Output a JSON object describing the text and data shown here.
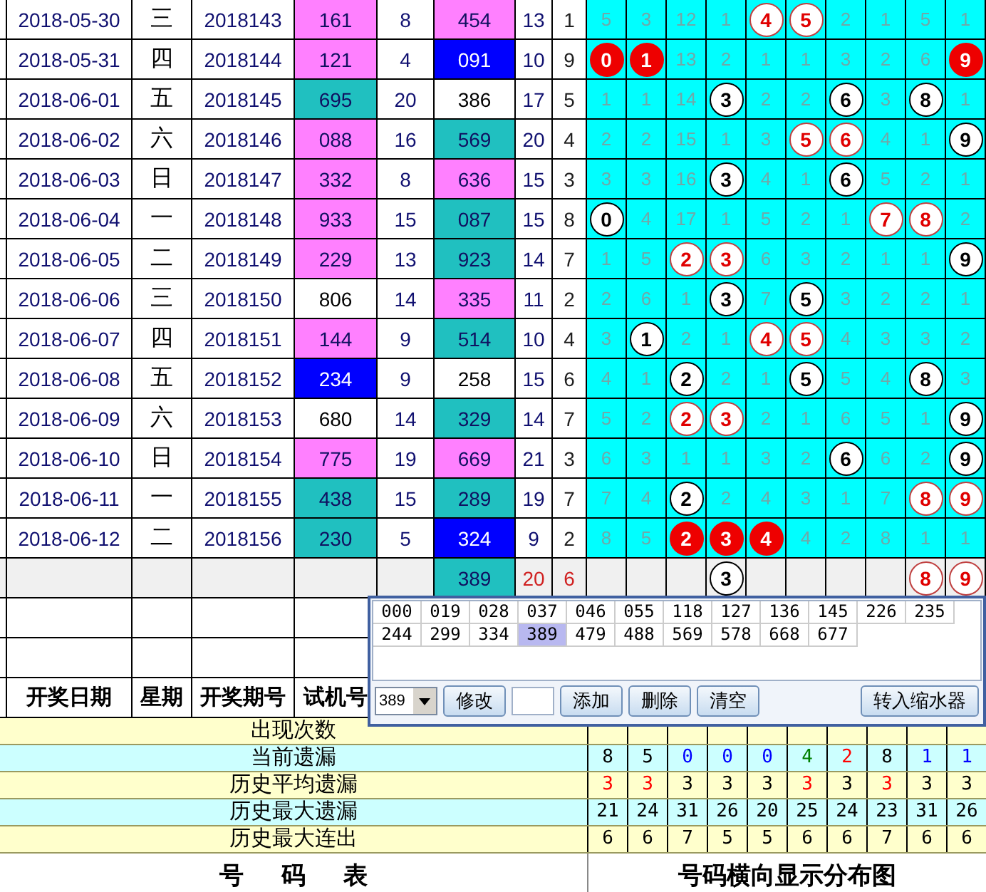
{
  "draws": [
    {
      "date": "2018-05-30",
      "weekday": "三",
      "period": "2018143",
      "trial": {
        "text": "161",
        "color": "#ff80ff"
      },
      "count": "8",
      "result": {
        "text": "454",
        "color": "#ff80ff"
      },
      "sum": "13",
      "span": "1",
      "grid": [
        {
          "text": "5",
          "kind": "gap"
        },
        {
          "text": "3",
          "kind": "gap"
        },
        {
          "text": "12",
          "kind": "gap"
        },
        {
          "text": "1",
          "kind": "gap"
        },
        {
          "text": "4",
          "kind": "red"
        },
        {
          "text": "5",
          "kind": "red"
        },
        {
          "text": "2",
          "kind": "gap"
        },
        {
          "text": "1",
          "kind": "gap"
        },
        {
          "text": "5",
          "kind": "gap"
        },
        {
          "text": "1",
          "kind": "gap"
        }
      ]
    },
    {
      "date": "2018-05-31",
      "weekday": "四",
      "period": "2018144",
      "trial": {
        "text": "121",
        "color": "#ff80ff"
      },
      "count": "4",
      "result": {
        "text": "091",
        "color": "#0000ff"
      },
      "sum": "10",
      "span": "9",
      "grid": [
        {
          "text": "0",
          "kind": "solid"
        },
        {
          "text": "1",
          "kind": "solid"
        },
        {
          "text": "13",
          "kind": "gap"
        },
        {
          "text": "2",
          "kind": "gap"
        },
        {
          "text": "1",
          "kind": "gap"
        },
        {
          "text": "1",
          "kind": "gap"
        },
        {
          "text": "3",
          "kind": "gap"
        },
        {
          "text": "2",
          "kind": "gap"
        },
        {
          "text": "6",
          "kind": "gap"
        },
        {
          "text": "9",
          "kind": "solid"
        }
      ]
    },
    {
      "date": "2018-06-01",
      "weekday": "五",
      "period": "2018145",
      "trial": {
        "text": "695",
        "color": "#20c0c0"
      },
      "count": "20",
      "result": {
        "text": "386",
        "color": "#ffffff"
      },
      "sum": "17",
      "span": "5",
      "grid": [
        {
          "text": "1",
          "kind": "gap"
        },
        {
          "text": "1",
          "kind": "gap"
        },
        {
          "text": "14",
          "kind": "gap"
        },
        {
          "text": "3",
          "kind": "black"
        },
        {
          "text": "2",
          "kind": "gap"
        },
        {
          "text": "2",
          "kind": "gap"
        },
        {
          "text": "6",
          "kind": "black"
        },
        {
          "text": "3",
          "kind": "gap"
        },
        {
          "text": "8",
          "kind": "black"
        },
        {
          "text": "1",
          "kind": "gap"
        }
      ]
    },
    {
      "date": "2018-06-02",
      "weekday": "六",
      "period": "2018146",
      "trial": {
        "text": "088",
        "color": "#ff80ff"
      },
      "count": "16",
      "result": {
        "text": "569",
        "color": "#20c0c0"
      },
      "sum": "20",
      "span": "4",
      "grid": [
        {
          "text": "2",
          "kind": "gap"
        },
        {
          "text": "2",
          "kind": "gap"
        },
        {
          "text": "15",
          "kind": "gap"
        },
        {
          "text": "1",
          "kind": "gap"
        },
        {
          "text": "3",
          "kind": "gap"
        },
        {
          "text": "5",
          "kind": "red"
        },
        {
          "text": "6",
          "kind": "red"
        },
        {
          "text": "4",
          "kind": "gap"
        },
        {
          "text": "1",
          "kind": "gap"
        },
        {
          "text": "9",
          "kind": "black"
        }
      ]
    },
    {
      "date": "2018-06-03",
      "weekday": "日",
      "period": "2018147",
      "trial": {
        "text": "332",
        "color": "#ff80ff"
      },
      "count": "8",
      "result": {
        "text": "636",
        "color": "#ff80ff"
      },
      "sum": "15",
      "span": "3",
      "grid": [
        {
          "text": "3",
          "kind": "gap"
        },
        {
          "text": "3",
          "kind": "gap"
        },
        {
          "text": "16",
          "kind": "gap"
        },
        {
          "text": "3",
          "kind": "black"
        },
        {
          "text": "4",
          "kind": "gap"
        },
        {
          "text": "1",
          "kind": "gap"
        },
        {
          "text": "6",
          "kind": "black"
        },
        {
          "text": "5",
          "kind": "gap"
        },
        {
          "text": "2",
          "kind": "gap"
        },
        {
          "text": "1",
          "kind": "gap"
        }
      ]
    },
    {
      "date": "2018-06-04",
      "weekday": "一",
      "period": "2018148",
      "trial": {
        "text": "933",
        "color": "#ff80ff"
      },
      "count": "15",
      "result": {
        "text": "087",
        "color": "#20c0c0"
      },
      "sum": "15",
      "span": "8",
      "grid": [
        {
          "text": "0",
          "kind": "black"
        },
        {
          "text": "4",
          "kind": "gap"
        },
        {
          "text": "17",
          "kind": "gap"
        },
        {
          "text": "1",
          "kind": "gap"
        },
        {
          "text": "5",
          "kind": "gap"
        },
        {
          "text": "2",
          "kind": "gap"
        },
        {
          "text": "1",
          "kind": "gap"
        },
        {
          "text": "7",
          "kind": "red"
        },
        {
          "text": "8",
          "kind": "red"
        },
        {
          "text": "2",
          "kind": "gap"
        }
      ]
    },
    {
      "date": "2018-06-05",
      "weekday": "二",
      "period": "2018149",
      "trial": {
        "text": "229",
        "color": "#ff80ff"
      },
      "count": "13",
      "result": {
        "text": "923",
        "color": "#20c0c0"
      },
      "sum": "14",
      "span": "7",
      "grid": [
        {
          "text": "1",
          "kind": "gap"
        },
        {
          "text": "5",
          "kind": "gap"
        },
        {
          "text": "2",
          "kind": "red"
        },
        {
          "text": "3",
          "kind": "red"
        },
        {
          "text": "6",
          "kind": "gap"
        },
        {
          "text": "3",
          "kind": "gap"
        },
        {
          "text": "2",
          "kind": "gap"
        },
        {
          "text": "1",
          "kind": "gap"
        },
        {
          "text": "1",
          "kind": "gap"
        },
        {
          "text": "9",
          "kind": "black"
        }
      ]
    },
    {
      "date": "2018-06-06",
      "weekday": "三",
      "period": "2018150",
      "trial": {
        "text": "806",
        "color": "#ffffff"
      },
      "count": "14",
      "result": {
        "text": "335",
        "color": "#ff80ff"
      },
      "sum": "11",
      "span": "2",
      "grid": [
        {
          "text": "2",
          "kind": "gap"
        },
        {
          "text": "6",
          "kind": "gap"
        },
        {
          "text": "1",
          "kind": "gap"
        },
        {
          "text": "3",
          "kind": "black"
        },
        {
          "text": "7",
          "kind": "gap"
        },
        {
          "text": "5",
          "kind": "black"
        },
        {
          "text": "3",
          "kind": "gap"
        },
        {
          "text": "2",
          "kind": "gap"
        },
        {
          "text": "2",
          "kind": "gap"
        },
        {
          "text": "1",
          "kind": "gap"
        }
      ]
    },
    {
      "date": "2018-06-07",
      "weekday": "四",
      "period": "2018151",
      "trial": {
        "text": "144",
        "color": "#ff80ff"
      },
      "count": "9",
      "result": {
        "text": "514",
        "color": "#20c0c0"
      },
      "sum": "10",
      "span": "4",
      "grid": [
        {
          "text": "3",
          "kind": "gap"
        },
        {
          "text": "1",
          "kind": "black"
        },
        {
          "text": "2",
          "kind": "gap"
        },
        {
          "text": "1",
          "kind": "gap"
        },
        {
          "text": "4",
          "kind": "red"
        },
        {
          "text": "5",
          "kind": "red"
        },
        {
          "text": "4",
          "kind": "gap"
        },
        {
          "text": "3",
          "kind": "gap"
        },
        {
          "text": "3",
          "kind": "gap"
        },
        {
          "text": "2",
          "kind": "gap"
        }
      ]
    },
    {
      "date": "2018-06-08",
      "weekday": "五",
      "period": "2018152",
      "trial": {
        "text": "234",
        "color": "#0000ff"
      },
      "count": "9",
      "result": {
        "text": "258",
        "color": "#ffffff"
      },
      "sum": "15",
      "span": "6",
      "grid": [
        {
          "text": "4",
          "kind": "gap"
        },
        {
          "text": "1",
          "kind": "gap"
        },
        {
          "text": "2",
          "kind": "black"
        },
        {
          "text": "2",
          "kind": "gap"
        },
        {
          "text": "1",
          "kind": "gap"
        },
        {
          "text": "5",
          "kind": "black"
        },
        {
          "text": "5",
          "kind": "gap"
        },
        {
          "text": "4",
          "kind": "gap"
        },
        {
          "text": "8",
          "kind": "black"
        },
        {
          "text": "3",
          "kind": "gap"
        }
      ]
    },
    {
      "date": "2018-06-09",
      "weekday": "六",
      "period": "2018153",
      "trial": {
        "text": "680",
        "color": "#ffffff"
      },
      "count": "14",
      "result": {
        "text": "329",
        "color": "#20c0c0"
      },
      "sum": "14",
      "span": "7",
      "grid": [
        {
          "text": "5",
          "kind": "gap"
        },
        {
          "text": "2",
          "kind": "gap"
        },
        {
          "text": "2",
          "kind": "red"
        },
        {
          "text": "3",
          "kind": "red"
        },
        {
          "text": "2",
          "kind": "gap"
        },
        {
          "text": "1",
          "kind": "gap"
        },
        {
          "text": "6",
          "kind": "gap"
        },
        {
          "text": "5",
          "kind": "gap"
        },
        {
          "text": "1",
          "kind": "gap"
        },
        {
          "text": "9",
          "kind": "black"
        }
      ]
    },
    {
      "date": "2018-06-10",
      "weekday": "日",
      "period": "2018154",
      "trial": {
        "text": "775",
        "color": "#ff80ff"
      },
      "count": "19",
      "result": {
        "text": "669",
        "color": "#ff80ff"
      },
      "sum": "21",
      "span": "3",
      "grid": [
        {
          "text": "6",
          "kind": "gap"
        },
        {
          "text": "3",
          "kind": "gap"
        },
        {
          "text": "1",
          "kind": "gap"
        },
        {
          "text": "1",
          "kind": "gap"
        },
        {
          "text": "3",
          "kind": "gap"
        },
        {
          "text": "2",
          "kind": "gap"
        },
        {
          "text": "6",
          "kind": "black"
        },
        {
          "text": "6",
          "kind": "gap"
        },
        {
          "text": "2",
          "kind": "gap"
        },
        {
          "text": "9",
          "kind": "black"
        }
      ]
    },
    {
      "date": "2018-06-11",
      "weekday": "一",
      "period": "2018155",
      "trial": {
        "text": "438",
        "color": "#20c0c0"
      },
      "count": "15",
      "result": {
        "text": "289",
        "color": "#20c0c0"
      },
      "sum": "19",
      "span": "7",
      "grid": [
        {
          "text": "7",
          "kind": "gap"
        },
        {
          "text": "4",
          "kind": "gap"
        },
        {
          "text": "2",
          "kind": "black"
        },
        {
          "text": "2",
          "kind": "gap"
        },
        {
          "text": "4",
          "kind": "gap"
        },
        {
          "text": "3",
          "kind": "gap"
        },
        {
          "text": "1",
          "kind": "gap"
        },
        {
          "text": "7",
          "kind": "gap"
        },
        {
          "text": "8",
          "kind": "red"
        },
        {
          "text": "9",
          "kind": "red"
        }
      ]
    },
    {
      "date": "2018-06-12",
      "weekday": "二",
      "period": "2018156",
      "trial": {
        "text": "230",
        "color": "#20c0c0"
      },
      "count": "5",
      "result": {
        "text": "324",
        "color": "#0000ff"
      },
      "sum": "9",
      "span": "2",
      "grid": [
        {
          "text": "8",
          "kind": "gap"
        },
        {
          "text": "5",
          "kind": "gap"
        },
        {
          "text": "2",
          "kind": "solid"
        },
        {
          "text": "3",
          "kind": "solid"
        },
        {
          "text": "4",
          "kind": "solid"
        },
        {
          "text": "4",
          "kind": "gap"
        },
        {
          "text": "2",
          "kind": "gap"
        },
        {
          "text": "8",
          "kind": "gap"
        },
        {
          "text": "1",
          "kind": "gap"
        },
        {
          "text": "1",
          "kind": "gap"
        }
      ]
    }
  ],
  "forecast": {
    "result": {
      "text": "389",
      "color": "#20c0c0"
    },
    "sum": "20",
    "span": "6",
    "grid": [
      {
        "kind": "empty"
      },
      {
        "kind": "empty"
      },
      {
        "kind": "empty"
      },
      {
        "text": "3",
        "kind": "black"
      },
      {
        "kind": "empty"
      },
      {
        "kind": "empty"
      },
      {
        "kind": "empty"
      },
      {
        "kind": "empty"
      },
      {
        "text": "8",
        "kind": "red"
      },
      {
        "text": "9",
        "kind": "red"
      }
    ]
  },
  "headers": [
    "开奖日期",
    "星期",
    "开奖期号",
    "试机号"
  ],
  "stats": [
    {
      "label": "出现次数"
    },
    {
      "label": "当前遗漏",
      "values": [
        {
          "text": "8",
          "color": "#000000"
        },
        {
          "text": "5",
          "color": "#000000"
        },
        {
          "text": "0",
          "color": "#0000ff"
        },
        {
          "text": "0",
          "color": "#0000ff"
        },
        {
          "text": "0",
          "color": "#0000ff"
        },
        {
          "text": "4",
          "color": "#008000"
        },
        {
          "text": "2",
          "color": "#ff0000"
        },
        {
          "text": "8",
          "color": "#000000"
        },
        {
          "text": "1",
          "color": "#0000ff"
        },
        {
          "text": "1",
          "color": "#0000ff"
        }
      ]
    },
    {
      "label": "历史平均遗漏",
      "values": [
        {
          "text": "3",
          "color": "#ff0000"
        },
        {
          "text": "3",
          "color": "#ff0000"
        },
        {
          "text": "3",
          "color": "#000000"
        },
        {
          "text": "3",
          "color": "#000000"
        },
        {
          "text": "3",
          "color": "#000000"
        },
        {
          "text": "3",
          "color": "#ff0000"
        },
        {
          "text": "3",
          "color": "#000000"
        },
        {
          "text": "3",
          "color": "#ff0000"
        },
        {
          "text": "3",
          "color": "#000000"
        },
        {
          "text": "3",
          "color": "#000000"
        }
      ]
    },
    {
      "label": "历史最大遗漏",
      "values": [
        {
          "text": "21"
        },
        {
          "text": "24"
        },
        {
          "text": "31"
        },
        {
          "text": "26"
        },
        {
          "text": "20"
        },
        {
          "text": "25"
        },
        {
          "text": "24"
        },
        {
          "text": "23"
        },
        {
          "text": "31"
        },
        {
          "text": "26"
        }
      ]
    },
    {
      "label": "历史最大连出",
      "values": [
        {
          "text": "6"
        },
        {
          "text": "6"
        },
        {
          "text": "7"
        },
        {
          "text": "5"
        },
        {
          "text": "5"
        },
        {
          "text": "6"
        },
        {
          "text": "6"
        },
        {
          "text": "7"
        },
        {
          "text": "6"
        },
        {
          "text": "6"
        }
      ]
    }
  ],
  "footer": {
    "left": "号 码 表",
    "right": "号码横向显示分布图"
  },
  "popup": {
    "numbers": [
      {
        "text": "000",
        "selected": false
      },
      {
        "text": "019",
        "selected": false
      },
      {
        "text": "028",
        "selected": false
      },
      {
        "text": "037",
        "selected": false
      },
      {
        "text": "046",
        "selected": false
      },
      {
        "text": "055",
        "selected": false
      },
      {
        "text": "118",
        "selected": false
      },
      {
        "text": "127",
        "selected": false
      },
      {
        "text": "136",
        "selected": false
      },
      {
        "text": "145",
        "selected": false
      },
      {
        "text": "226",
        "selected": false
      },
      {
        "text": "235",
        "selected": false
      },
      {
        "text": "244",
        "selected": false
      },
      {
        "text": "299",
        "selected": false
      },
      {
        "text": "334",
        "selected": false
      },
      {
        "text": "389",
        "selected": true
      },
      {
        "text": "479",
        "selected": false
      },
      {
        "text": "488",
        "selected": false
      },
      {
        "text": "569",
        "selected": false
      },
      {
        "text": "578",
        "selected": false
      },
      {
        "text": "668",
        "selected": false
      },
      {
        "text": "677",
        "selected": false
      }
    ],
    "controls": [
      {
        "kind": "select",
        "value": "389"
      },
      {
        "kind": "button",
        "label": "修改"
      },
      {
        "kind": "input"
      },
      {
        "kind": "button",
        "label": "添加"
      },
      {
        "kind": "button",
        "label": "删除"
      },
      {
        "kind": "button",
        "label": "清空"
      }
    ],
    "side_button": "转入缩水器"
  }
}
